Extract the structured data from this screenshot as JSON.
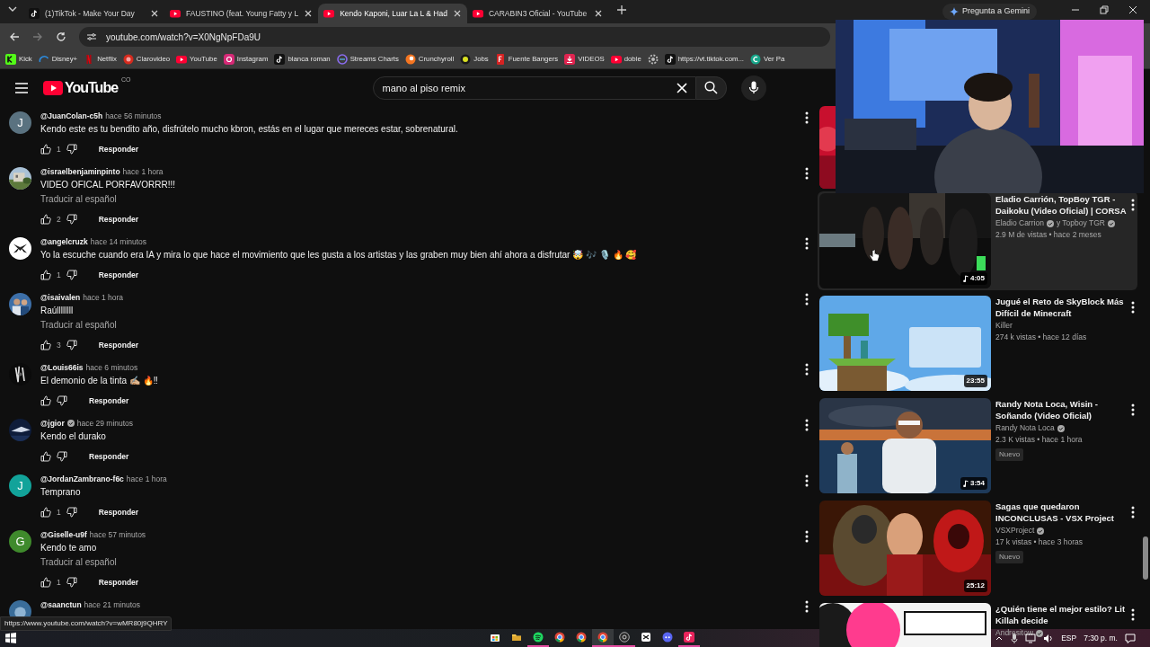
{
  "browser": {
    "tabs": [
      {
        "title": "(1)TikTok - Make Your Day",
        "kind": "tiktok",
        "selected": false
      },
      {
        "title": "FAUSTINO (feat. Young Fatty y L",
        "kind": "youtube",
        "selected": false
      },
      {
        "title": "Kendo Kaponi, Luar La L & Had",
        "kind": "youtube",
        "selected": true
      },
      {
        "title": "CARABIN3 Oficial - YouTube",
        "kind": "youtube",
        "selected": false
      }
    ],
    "gemini_button": "Pregunta a Gemini",
    "url": "youtube.com/watch?v=X0NgNpFDa9U",
    "bookmarks": [
      {
        "label": "Kick"
      },
      {
        "label": "Disney+"
      },
      {
        "label": "Netflix"
      },
      {
        "label": "Clarovideo"
      },
      {
        "label": "YouTube"
      },
      {
        "label": "Instagram"
      },
      {
        "label": "blanca roman"
      },
      {
        "label": "Streams Charts"
      },
      {
        "label": "Crunchyroll"
      },
      {
        "label": "Jobs"
      },
      {
        "label": "Fuente Bangers"
      },
      {
        "label": "VIDEOS"
      },
      {
        "label": "doble"
      },
      {
        "kind": "icon"
      },
      {
        "label": "https://vt.tiktok.com..."
      },
      {
        "label": "Ver Pa"
      }
    ]
  },
  "youtube": {
    "logo_text": "YouTube",
    "country": "CO",
    "search": {
      "value": "mano al piso remix"
    }
  },
  "comments": [
    {
      "author": "@JuanColan-c5h",
      "verified": false,
      "time": "hace 56 minutos",
      "avatar": {
        "kind": "letter",
        "letter": "J",
        "color": "#5a7280"
      },
      "text": "Kendo este es tu bendito año, disfrútelo mucho kbron, estás en el lugar que mereces estar, sobrenatural.",
      "likes": "1",
      "reply": "Responder"
    },
    {
      "author": "@israelbenjaminpinto",
      "verified": false,
      "time": "hace 1 hora",
      "avatar": {
        "kind": "picture"
      },
      "text": "VIDEO OFICAL PORFAVORRR!!!",
      "translate": "Traducir al español",
      "likes": "2",
      "reply": "Responder"
    },
    {
      "author": "@angelcruzk",
      "verified": false,
      "time": "hace 14 minutos",
      "avatar": {
        "kind": "picture"
      },
      "text": "Yo la escuche cuando era IA y mira lo que hace el movimiento que les gusta a los artistas y las graben muy bien ahí ahora a disfrutar 🤯 🎶 🎙️ 🔥 🥰",
      "likes": "1",
      "reply": "Responder"
    },
    {
      "author": "@isaivalen",
      "verified": false,
      "time": "hace 1 hora",
      "avatar": {
        "kind": "picture"
      },
      "text": "Raúllllllll",
      "translate": "Traducir al español",
      "likes": "3",
      "reply": "Responder"
    },
    {
      "author": "@Louis66is",
      "verified": false,
      "time": "hace 6 minutos",
      "avatar": {
        "kind": "picture"
      },
      "text": "El demonio de la tinta ✍🏼 🔥‼",
      "reply": "Responder"
    },
    {
      "author": "@jgior",
      "verified": true,
      "time": "hace 29 minutos",
      "avatar": {
        "kind": "picture"
      },
      "text": "Kendo el durako",
      "reply": "Responder"
    },
    {
      "author": "@JordanZambrano-f6c",
      "verified": false,
      "time": "hace 1 hora",
      "avatar": {
        "kind": "letter",
        "letter": "J",
        "color": "#12a39a"
      },
      "text": "Temprano",
      "likes": "1",
      "reply": "Responder"
    },
    {
      "author": "@Giselle-u9f",
      "verified": false,
      "time": "hace 57 minutos",
      "avatar": {
        "kind": "letter",
        "letter": "G",
        "color": "#3f8a2c"
      },
      "text": "Kendo te amo",
      "translate": "Traducir al español",
      "likes": "1",
      "reply": "Responder"
    },
    {
      "author": "@saanctun",
      "verified": false,
      "time": "hace 21 minutos",
      "avatar": {
        "kind": "picture"
      }
    }
  ],
  "videos": [
    {
      "kind": "picture"
    },
    {
      "title": "Eladio Carrión, TopBoy TGR - Daikoku (Video Oficial) | CORSA",
      "channels": [
        {
          "name": "Eladio Carrion",
          "verified": true
        },
        {
          "name": "y Topboy TGR",
          "verified": true
        }
      ],
      "meta": "2.9 M de vistas • hace 2 meses",
      "duration": "4:05",
      "music": true,
      "hovered": true
    },
    {
      "title": "Jugué el Reto de SkyBlock Más Difícil de Minecraft",
      "channels": [
        {
          "name": "Killer",
          "verified": false
        }
      ],
      "meta": "274 k vistas • hace 12 días",
      "duration": "23:55",
      "music": false,
      "hovered": false
    },
    {
      "title": "Randy Nota Loca, Wisin - Soñando (Video Oficial)",
      "channels": [
        {
          "name": "Randy Nota Loca",
          "verified": true
        }
      ],
      "meta": "2.3 K vistas • hace 1 hora",
      "badge": "Nuevo",
      "duration": "3:54",
      "music": true,
      "hovered": false
    },
    {
      "title": "Sagas que quedaron INCONCLUSAS - VSX Project",
      "channels": [
        {
          "name": "VSXProject",
          "verified": true
        }
      ],
      "meta": "17 k vistas • hace 3 horas",
      "badge": "Nuevo",
      "duration": "25:12",
      "music": false,
      "hovered": false
    },
    {
      "title": "¿Quién tiene el mejor estilo? Lit Killah decide",
      "channels": [
        {
          "name": "Andresitow",
          "verified": true
        }
      ],
      "hovered": false
    }
  ],
  "status_url": "https://www.youtube.com/watch?v=wMR80j9QHRY",
  "webcam": {
    "kind": "picture"
  },
  "taskbar": {
    "apps": [
      {
        "open": false,
        "selected": false
      },
      {
        "open": false,
        "selected": false
      },
      {
        "open": true,
        "selected": false
      },
      {
        "open": false,
        "selected": false
      },
      {
        "open": false,
        "selected": false
      },
      {
        "open": true,
        "selected": true
      },
      {
        "open": true,
        "selected": false
      },
      {
        "open": false,
        "selected": false
      },
      {
        "open": false,
        "selected": false
      },
      {
        "open": true,
        "selected": false
      }
    ],
    "language": "ESP",
    "clock": "7:30 p. m."
  }
}
